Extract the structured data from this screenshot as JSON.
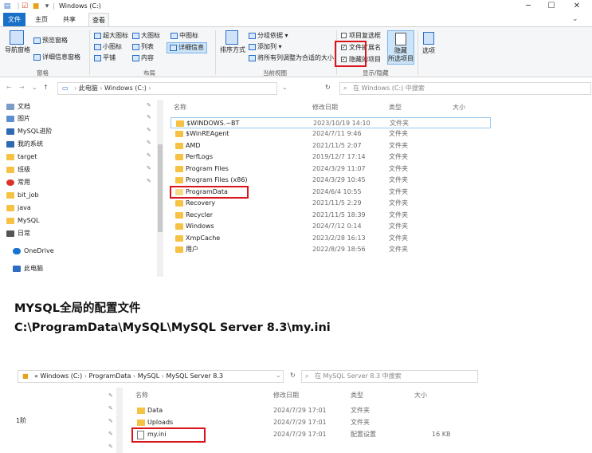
{
  "window": {
    "title": "Windows (C:)",
    "minimize": "─",
    "maximize": "☐",
    "close": "✕"
  },
  "ribbon_tabs": [
    "文件",
    "主页",
    "共享",
    "查看"
  ],
  "ribbon": {
    "pane_group": {
      "nav_pane": "导航窗格",
      "preview_pane": "预览窗格",
      "details_pane": "详细信息窗格",
      "label": "窗格"
    },
    "layout_group": {
      "items": [
        "超大图标",
        "大图标",
        "中图标",
        "小图标",
        "列表",
        "详细信息",
        "平铺",
        "内容"
      ],
      "label": "布局"
    },
    "view_group": {
      "sort": "排序方式",
      "group_by": "分组依据",
      "add_columns": "添加列",
      "size_all": "将所有列调整为合适的大小",
      "label": "当前视图"
    },
    "show_group": {
      "item_checkboxes": "项目复选框",
      "file_ext": "文件扩展名",
      "hidden_items": "隐藏的项目",
      "hide_selected": "隐藏",
      "hide_selected_2": "所选项目",
      "label": "显示/隐藏"
    },
    "options": "选项"
  },
  "address": {
    "path": [
      "此电脑",
      "Windows (C:)"
    ],
    "search_placeholder": "在 Windows (C:) 中搜索"
  },
  "nav_pane": {
    "items": [
      "文档",
      "图片",
      "MySQL进阶",
      "我的系统",
      "target",
      "班级",
      "常用",
      "bit_job",
      "java",
      "MySQL",
      "日常",
      "OneDrive",
      "此电脑"
    ]
  },
  "columns": {
    "name": "名称",
    "modified": "修改日期",
    "type": "类型",
    "size": "大小"
  },
  "files": [
    {
      "name": "$WINDOWS.~BT",
      "date": "2023/10/19 14:10",
      "type": "文件夹"
    },
    {
      "name": "$WinREAgent",
      "date": "2024/7/11 9:46",
      "type": "文件夹"
    },
    {
      "name": "AMD",
      "date": "2021/11/5 2:07",
      "type": "文件夹"
    },
    {
      "name": "PerfLogs",
      "date": "2019/12/7 17:14",
      "type": "文件夹"
    },
    {
      "name": "Program Files",
      "date": "2024/3/29 11:07",
      "type": "文件夹"
    },
    {
      "name": "Program Files (x86)",
      "date": "2024/3/29 10:45",
      "type": "文件夹"
    },
    {
      "name": "ProgramData",
      "date": "2024/6/4 10:55",
      "type": "文件夹"
    },
    {
      "name": "Recovery",
      "date": "2021/11/5 2:29",
      "type": "文件夹"
    },
    {
      "name": "Recycler",
      "date": "2021/11/5 18:39",
      "type": "文件夹"
    },
    {
      "name": "Windows",
      "date": "2024/7/12 0:14",
      "type": "文件夹"
    },
    {
      "name": "XmpCache",
      "date": "2023/2/28 16:13",
      "type": "文件夹"
    },
    {
      "name": "用户",
      "date": "2022/8/29 18:56",
      "type": "文件夹"
    }
  ],
  "headings": {
    "line1": "MYSQL全局的配置文件",
    "line2": "C:\\ProgramData\\MySQL\\MySQL Server 8.3\\my.ini"
  },
  "bottom": {
    "path": [
      "«",
      "Windows (C:)",
      "ProgramData",
      "MySQL",
      "MySQL Server 8.3"
    ],
    "search_placeholder": "在 MySQL Server 8.3 中搜索",
    "nav_label": "1阶",
    "columns": {
      "name": "名称",
      "modified": "修改日期",
      "type": "类型",
      "size": "大小"
    },
    "files": [
      {
        "name": "Data",
        "date": "2024/7/29 17:01",
        "type": "文件夹",
        "size": ""
      },
      {
        "name": "Uploads",
        "date": "2024/7/29 17:01",
        "type": "文件夹",
        "size": ""
      },
      {
        "name": "my.ini",
        "date": "2024/7/29 17:01",
        "type": "配置设置",
        "size": "16 KB"
      }
    ]
  }
}
